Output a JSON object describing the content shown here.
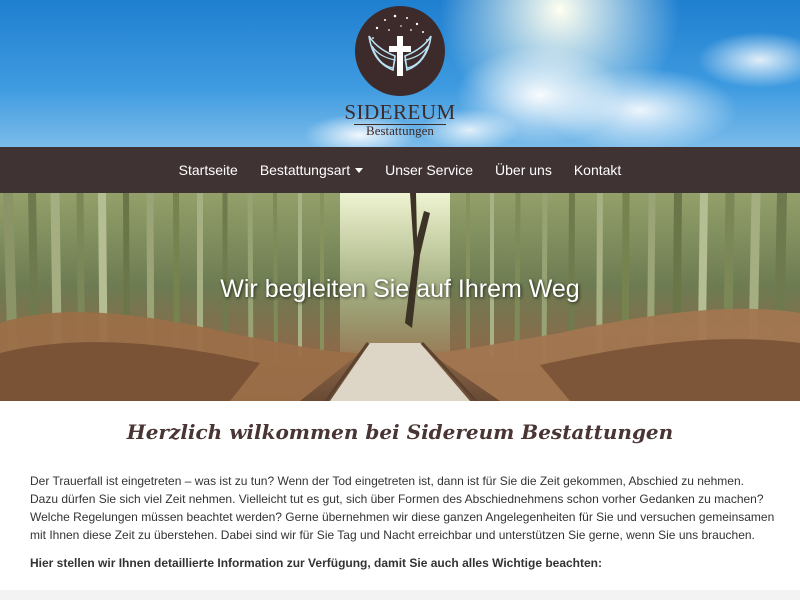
{
  "brand": {
    "name": "SIDEREUM",
    "subtitle": "Bestattungen"
  },
  "nav": {
    "items": [
      {
        "label": "Startseite"
      },
      {
        "label": "Bestattungsart",
        "dropdown": true
      },
      {
        "label": "Unser Service"
      },
      {
        "label": "Über uns"
      },
      {
        "label": "Kontakt"
      }
    ]
  },
  "hero": {
    "title": "Wir begleiten Sie auf Ihrem Weg"
  },
  "content": {
    "heading": "Herzlich wilkommen bei Sidereum Bestattungen",
    "intro": "Der Trauerfall ist eingetreten – was ist zu tun? Wenn der Tod eingetreten ist, dann ist für Sie die Zeit gekommen, Abschied zu nehmen. Dazu dürfen Sie sich viel Zeit nehmen. Vielleicht tut es gut, sich über Formen des Abschiednehmens schon vorher Gedanken zu machen? Welche Regelungen müssen beachtet werden? Gerne übernehmen wir diese ganzen Angelegenheiten für Sie und versuchen gemeinsamen mit Ihnen diese Zeit zu überstehen. Dabei sind wir für Sie Tag und Nacht erreichbar und unterstützen Sie gerne, wenn Sie uns brauchen.",
    "info_line": "Hier stellen wir Ihnen detaillierte Information zur Verfügung, damit Sie auch alles Wichtige beachten:"
  },
  "colors": {
    "brand_dark": "#3f3333",
    "heading": "#4a3535"
  }
}
